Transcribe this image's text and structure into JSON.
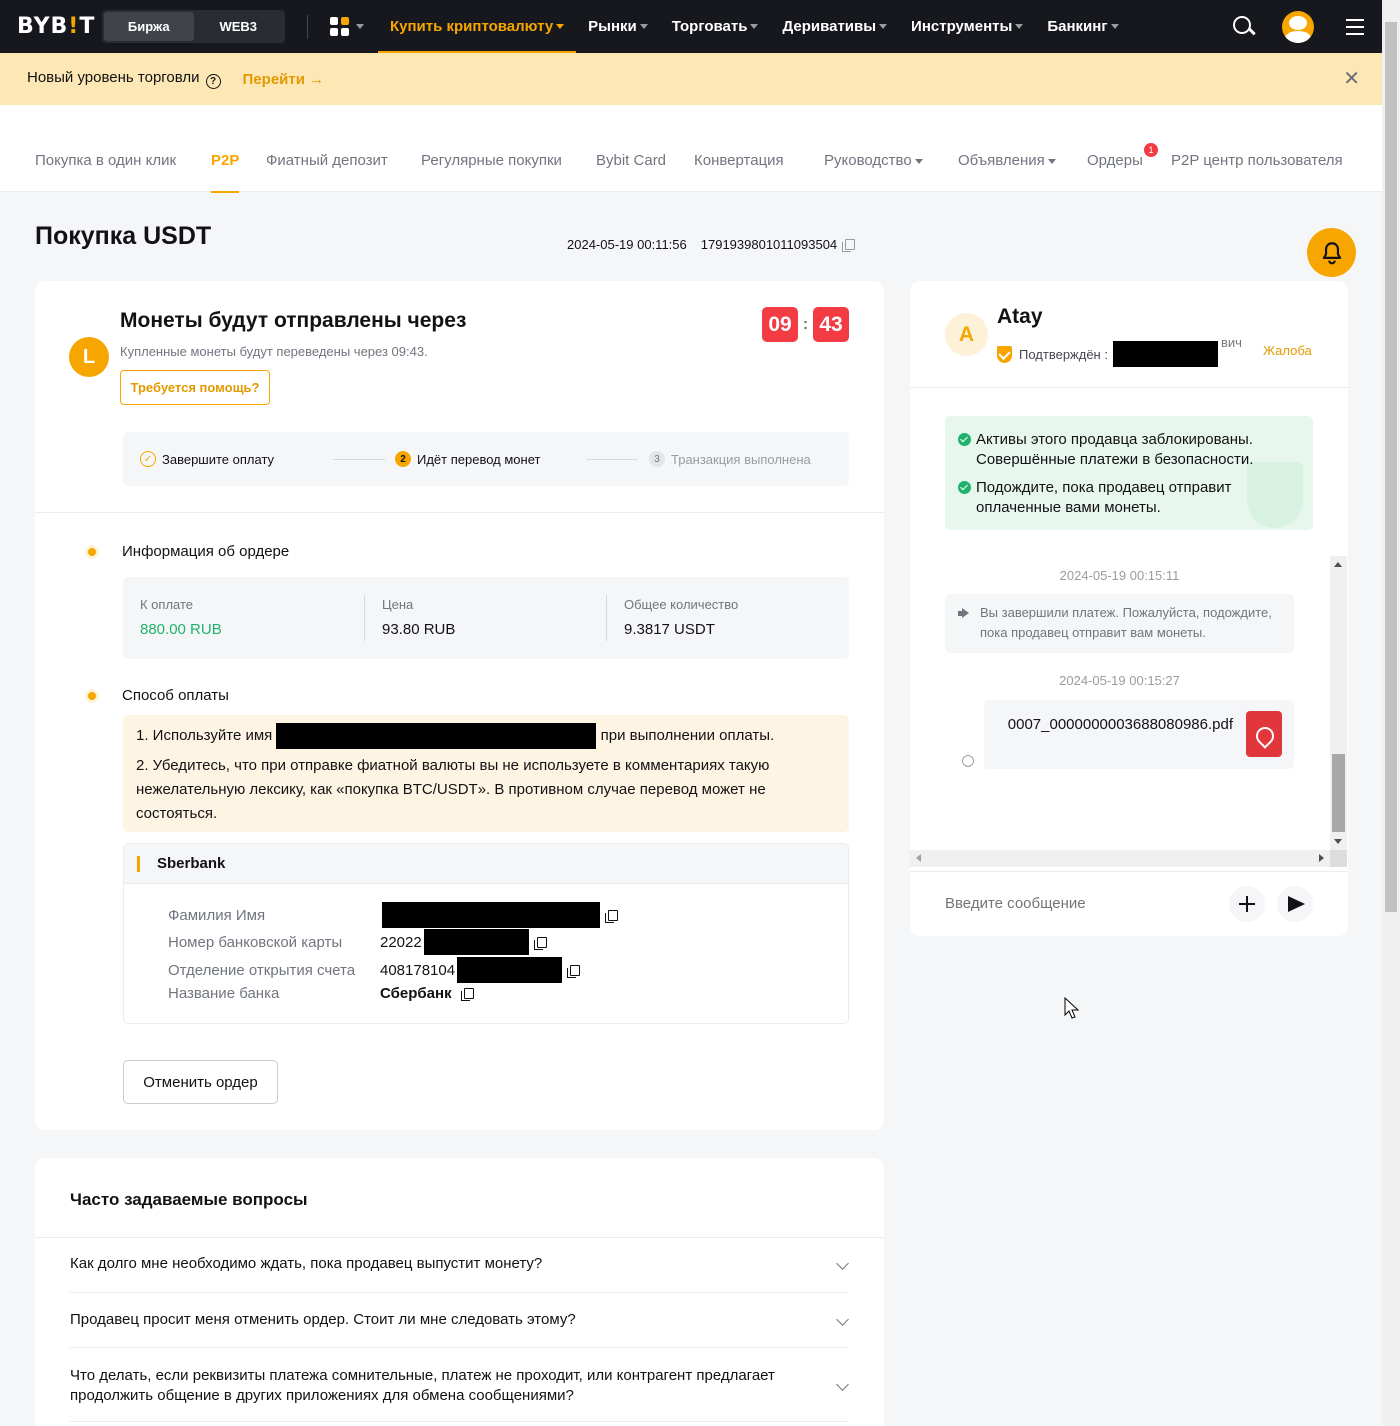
{
  "topnav": {
    "logo_left": "BYB",
    "logo_bar": "!",
    "logo_right": "T",
    "switch": [
      "Биржа",
      "WEB3"
    ],
    "links": [
      {
        "label": "Купить криптовалюту",
        "active": true
      },
      {
        "label": "Рынки"
      },
      {
        "label": "Торговать"
      },
      {
        "label": "Деривативы"
      },
      {
        "label": "Инструменты"
      },
      {
        "label": "Банкинг"
      }
    ],
    "icons": [
      "apps-icon",
      "search-icon",
      "user-avatar",
      "menu-icon"
    ]
  },
  "banner": {
    "text": "Новый уровень торговли",
    "link": "Перейти →",
    "close": "✕"
  },
  "subnav": {
    "items": [
      {
        "label": "Покупка в один клик"
      },
      {
        "label": "P2P",
        "active": true
      },
      {
        "label": "Фиатный депозит"
      },
      {
        "label": "Регулярные покупки"
      },
      {
        "label": "Bybit Card"
      },
      {
        "label": "Конвертация"
      },
      {
        "label": "Руководство"
      },
      {
        "label": "Объявления"
      },
      {
        "label": "Ордеры"
      },
      {
        "label": "P2P центр пользователя"
      }
    ],
    "orders_badge": "1"
  },
  "page": {
    "title": "Покупка USDT",
    "order_time": "2024-05-19 00:11:56",
    "order_id": "1791939801011093504"
  },
  "status": {
    "avatar_letter": "L",
    "title": "Монеты будут отправлены через",
    "subtitle": "Купленные монеты будут переведены через 09:43.",
    "help_button": "Требуется помощь?",
    "timer_min": "09",
    "timer_sep": ":",
    "timer_sec": "43"
  },
  "steps": [
    {
      "num": "✓",
      "label": "Завершите оплату",
      "state": "done"
    },
    {
      "num": "2",
      "label": "Идёт перевод монет",
      "state": "current"
    },
    {
      "num": "3",
      "label": "Транзакция выполнена",
      "state": "next"
    }
  ],
  "order_info": {
    "title": "Информация об ордере",
    "cols": [
      {
        "label": "К оплате",
        "value": "880.00 RUB"
      },
      {
        "label": "Цена",
        "value": "93.80 RUB"
      },
      {
        "label": "Общее количество",
        "value": "9.3817 USDT"
      }
    ]
  },
  "payment": {
    "title": "Способ оплаты",
    "note1_pre": "1. Используйте имя",
    "note1_post": "при выполнении оплаты.",
    "note2": "2. Убедитесь, что при отправке фиатной валюты вы не используете в комментариях такую нежелательную лексику, как «покупка BTC/USDT». В противном случае перевод может не состояться.",
    "bank_name": "Sberbank",
    "rows": [
      {
        "key": "Фамилия Имя",
        "value": ""
      },
      {
        "key": "Номер банковской карты",
        "value": "22022"
      },
      {
        "key": "Отделение открытия счета",
        "value": "408178104"
      },
      {
        "key": "Название банка",
        "value": "Сбербанк"
      }
    ],
    "cancel_button": "Отменить ордер"
  },
  "faq": {
    "title": "Часто задаваемые вопросы",
    "items": [
      "Как долго мне необходимо ждать, пока продавец выпустит монету?",
      "Продавец просит меня отменить ордер. Стоит ли мне следовать этому?",
      "Что делать, если реквизиты платежа сомнительные, платеж не проходит, или контрагент предлагает продолжить общение в других приложениях для обмена сообщениями?"
    ]
  },
  "chat": {
    "avatar_letter": "A",
    "seller": "Atay",
    "verified": "Подтверждён :",
    "name_suffix": "вич",
    "complain": "Жалоба",
    "safe_notes": [
      "Активы этого продавца заблокированы. Совершённые платежи в безопасности.",
      "Подождите, пока продавец отправит оплаченные вами монеты."
    ],
    "messages": [
      {
        "time": "2024-05-19 00:15:11",
        "text": "Вы завершили платеж. Пожалуйста, подождите, пока продавец отправит вам монеты."
      },
      {
        "time": "2024-05-19 00:15:27",
        "file": "0007_0000000003688080986.pdf"
      }
    ],
    "input_placeholder": "Введите сообщение"
  },
  "colors": {
    "accent": "#f7a600",
    "nav_bg": "#17181e",
    "banner_bg": "#fde8b5",
    "timer_red": "#f23b43",
    "green": "#20b26c"
  }
}
